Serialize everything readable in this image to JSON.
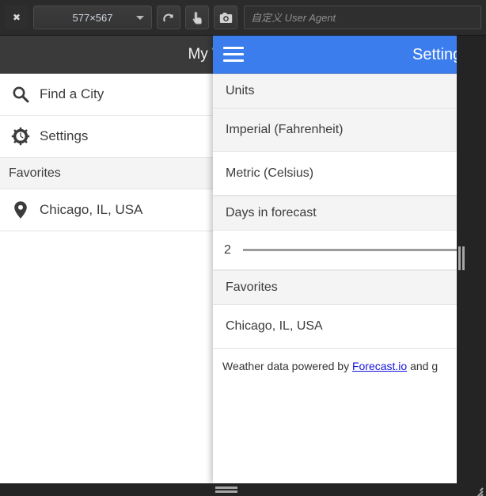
{
  "toolbar": {
    "close_label": "✖",
    "size_label": "577×567",
    "rotate_icon": "rotate-icon",
    "touch_icon": "touch-pointer-icon",
    "camera_icon": "camera-icon",
    "user_agent_placeholder": "自定义 User Agent",
    "user_agent_value": ""
  },
  "app": {
    "header_title": "My Weather",
    "nav": [
      {
        "label": "Find a City",
        "icon": "search-icon"
      },
      {
        "label": "Settings",
        "icon": "gear-icon"
      }
    ],
    "favorites_header": "Favorites",
    "favorites": [
      {
        "label": "Chicago, IL, USA",
        "icon": "map-pin-icon"
      }
    ]
  },
  "panel": {
    "menu_icon": "hamburger-menu-icon",
    "title": "Settings",
    "sections": [
      {
        "header": "Units",
        "options": [
          {
            "label": "Imperial (Fahrenheit)",
            "selected": true
          },
          {
            "label": "Metric (Celsius)",
            "selected": false
          }
        ]
      },
      {
        "header": "Days in forecast",
        "slider_value": "2"
      },
      {
        "header": "Favorites",
        "options": [
          {
            "label": "Chicago, IL, USA",
            "selected": false
          }
        ]
      }
    ],
    "footer": {
      "prefix": "Weather data powered by ",
      "link": "Forecast.io",
      "suffix": " and g"
    }
  },
  "colors": {
    "accent_blue": "#3b7ded",
    "app_header_dark": "#3a3a3a",
    "chrome_dark": "#242424",
    "link_blue": "#1414dd"
  }
}
